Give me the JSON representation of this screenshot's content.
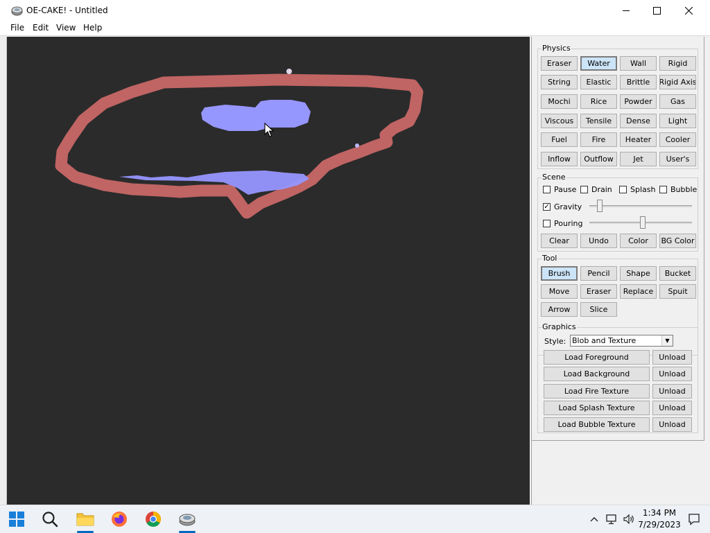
{
  "window": {
    "title": "OE-CAKE! - Untitled",
    "minimize_glyph": "—",
    "maximize_glyph": "☐",
    "close_glyph": "✕"
  },
  "menu": [
    "File",
    "Edit",
    "View",
    "Help"
  ],
  "physics": {
    "title": "Physics",
    "buttons": [
      "Eraser",
      "Water",
      "Wall",
      "Rigid",
      "String",
      "Elastic",
      "Brittle",
      "Rigid Axis",
      "Mochi",
      "Rice",
      "Powder",
      "Gas",
      "Viscous",
      "Tensile",
      "Dense",
      "Light",
      "Fuel",
      "Fire",
      "Heater",
      "Cooler",
      "Inflow",
      "Outflow",
      "Jet",
      "User's"
    ],
    "selected": "Water"
  },
  "scene": {
    "title": "Scene",
    "pause": {
      "label": "Pause",
      "checked": false
    },
    "drain": {
      "label": "Drain",
      "checked": false
    },
    "splash": {
      "label": "Splash",
      "checked": false
    },
    "bubble": {
      "label": "Bubble",
      "checked": false
    },
    "gravity": {
      "label": "Gravity",
      "checked": true,
      "level": 0.08
    },
    "pouring": {
      "label": "Pouring",
      "checked": false,
      "level": 0.52
    },
    "buttons": [
      "Clear",
      "Undo",
      "Color",
      "BG Color"
    ]
  },
  "tool": {
    "title": "Tool",
    "buttons": [
      "Brush",
      "Pencil",
      "Shape",
      "Bucket",
      "Move",
      "Eraser",
      "Replace",
      "Spuit",
      "Arrow",
      "Slice"
    ],
    "selected": "Brush"
  },
  "graphics": {
    "title": "Graphics",
    "style_label": "Style:",
    "style_value": "Blob and Texture",
    "loads": [
      "Load Foreground",
      "Load Background",
      "Load Fire Texture",
      "Load Splash Texture",
      "Load Bubble Texture"
    ],
    "unload_label": "Unload"
  },
  "colors": {
    "canvas_bg": "#2b2b2b",
    "wall": "#c06464",
    "water": "#9696ff"
  },
  "taskbar": {
    "icons": [
      "windows-start-icon",
      "search-icon",
      "file-explorer-icon",
      "firefox-icon",
      "chrome-icon",
      "oe-cake-icon"
    ],
    "time": "1:34 PM",
    "date": "7/29/2023"
  }
}
